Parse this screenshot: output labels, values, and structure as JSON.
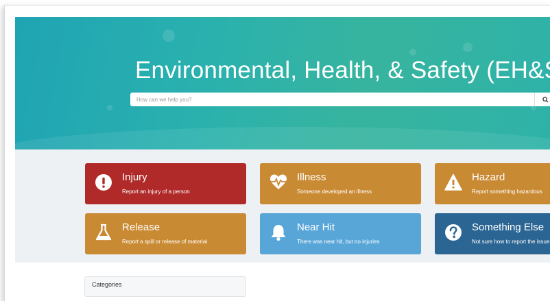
{
  "hero": {
    "title": "Environmental, Health, & Safety (EH&S)",
    "search_placeholder": "How can we help you?"
  },
  "cards": [
    {
      "title": "Injury",
      "desc": "Report an injury of a person",
      "icon": "exclamation-circle-icon",
      "color": "#b02a2a"
    },
    {
      "title": "Illness",
      "desc": "Someone developed an illness",
      "icon": "heartbeat-icon",
      "color": "#c98a34"
    },
    {
      "title": "Hazard",
      "desc": "Report something hazardous",
      "icon": "warning-triangle-icon",
      "color": "#c98a34"
    },
    {
      "title": "Release",
      "desc": "Report a spill or release of material",
      "icon": "flask-icon",
      "color": "#c98a34"
    },
    {
      "title": "Near Hit",
      "desc": "There was near hit, but no injuries",
      "icon": "bell-icon",
      "color": "#58a6d8"
    },
    {
      "title": "Something Else",
      "desc": "Not sure how to report the issue",
      "icon": "question-circle-icon",
      "color": "#2b6593"
    }
  ],
  "categories": {
    "label": "Categories"
  }
}
